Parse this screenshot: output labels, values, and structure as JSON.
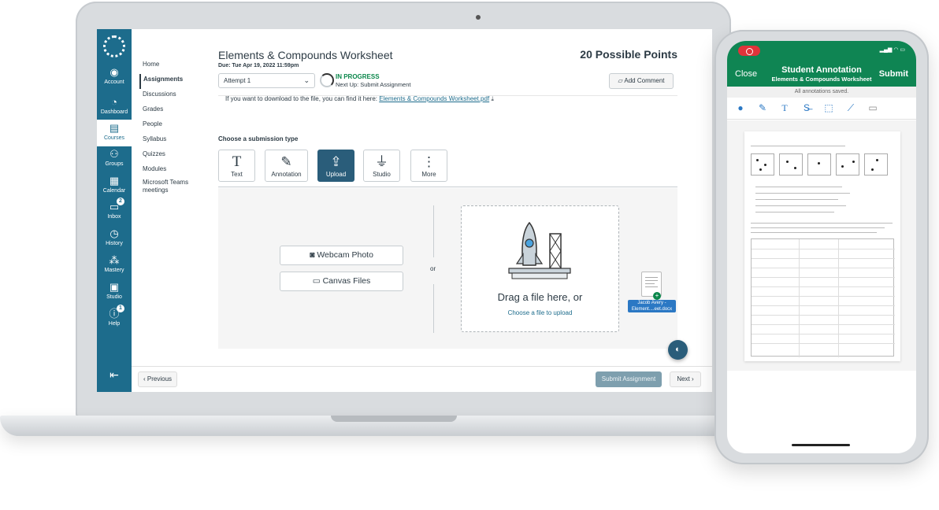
{
  "sidebar": {
    "items": [
      {
        "label": "Account",
        "icon": "account-icon"
      },
      {
        "label": "Dashboard",
        "icon": "dashboard-icon"
      },
      {
        "label": "Courses",
        "icon": "courses-icon"
      },
      {
        "label": "Groups",
        "icon": "groups-icon"
      },
      {
        "label": "Calendar",
        "icon": "calendar-icon"
      },
      {
        "label": "Inbox",
        "icon": "inbox-icon",
        "badge": "2"
      },
      {
        "label": "History",
        "icon": "history-icon"
      },
      {
        "label": "Mastery",
        "icon": "mastery-icon"
      },
      {
        "label": "Studio",
        "icon": "studio-icon"
      },
      {
        "label": "Help",
        "icon": "help-icon",
        "badge": "1"
      }
    ]
  },
  "course_nav": {
    "items": [
      "Home",
      "Assignments",
      "Discussions",
      "Grades",
      "People",
      "Syllabus",
      "Quizzes",
      "Modules",
      "Microsoft Teams meetings"
    ]
  },
  "assignment": {
    "title": "Elements & Compounds Worksheet",
    "points": "20 Possible Points",
    "due": "Due: Tue Apr 19, 2022 11:59pm",
    "attempt": "Attempt 1",
    "status": "IN PROGRESS",
    "next_up": "Next Up: Submit Assignment",
    "add_comment": "Add Comment",
    "download_text": "If you want to download to the file, you can find it here:",
    "download_link": "Elements & Compounds Worksheet.pdf",
    "choose_type": "Choose a submission type"
  },
  "submission_types": [
    "Text",
    "Annotation",
    "Upload",
    "Studio",
    "More"
  ],
  "upload": {
    "webcam": "Webcam Photo",
    "canvas_files": "Canvas Files",
    "or": "or",
    "drag": "Drag a file here, or",
    "choose": "Choose a file to upload",
    "dragged_file": "Jacob Avery - Element....eet.docx"
  },
  "footer": {
    "previous": "Previous",
    "submit": "Submit Assignment",
    "next": "Next"
  },
  "phone": {
    "close": "Close",
    "title": "Student Annotation",
    "subtitle": "Elements & Compounds Worksheet",
    "submit": "Submit",
    "saved": "All annotations saved."
  },
  "colors": {
    "nav": "#1d6c8c",
    "active_type": "#2a5d7a",
    "status_green": "#0b874b",
    "phone_header": "#0f8553"
  }
}
